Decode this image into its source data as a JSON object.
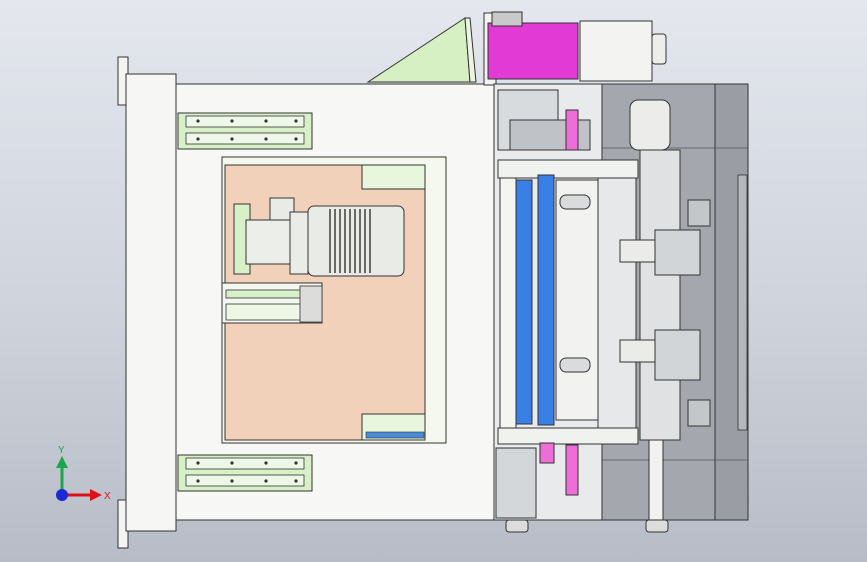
{
  "viewport": {
    "kind": "CAD 3D model view",
    "background": [
      "#e4e7ee",
      "#b7bcc6"
    ]
  },
  "triad": {
    "x_label": "X",
    "y_label": "Y",
    "x_color": "#e0101a",
    "y_color": "#1aa64a",
    "z_color": "#1a2ad8"
  },
  "colors": {
    "frame": "#f4f4f2",
    "outline": "#2a2a2a",
    "panel": "#f2d2bc",
    "green_part": "#d7f0c8",
    "motor": "#e8ebe6",
    "magenta": "#e23ad4",
    "roller_blue": "#3a7fe6",
    "rod_pink": "#ee6ed8",
    "steel": "#c9ccd0",
    "dark_frame": "#9da1a8"
  }
}
